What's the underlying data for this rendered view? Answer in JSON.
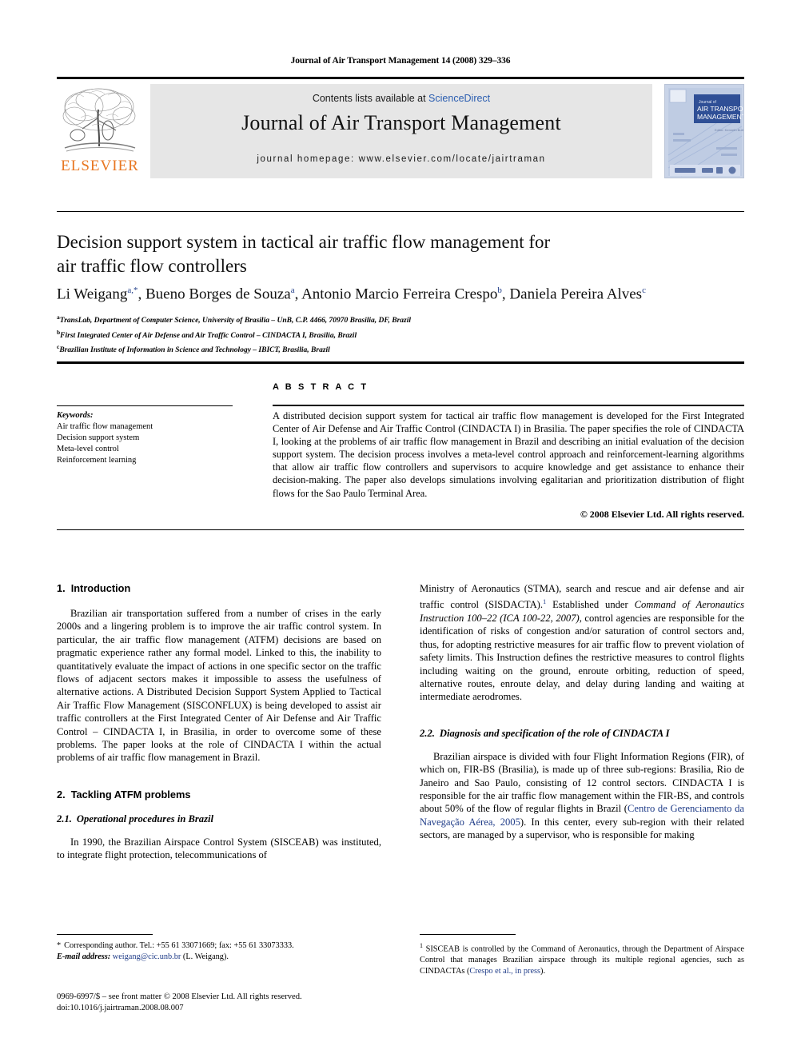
{
  "running_head": "Journal of Air Transport Management 14 (2008) 329–336",
  "masthead": {
    "contents_prefix": "Contents lists available at ",
    "sciencedirect": "ScienceDirect",
    "journal_title": "Journal of Air Transport Management",
    "homepage": "journal homepage: www.elsevier.com/locate/jairtraman",
    "publisher_name": "ELSEVIER",
    "cover_line1": "Journal of",
    "cover_line2": "AIR TRANSPORT",
    "cover_line3": "MANAGEMENT",
    "accent_orange": "#E87722",
    "link_blue": "#2a5db0",
    "band_gray": "#e6e6e6"
  },
  "title": {
    "line1": "Decision support system in tactical air traffic flow management for",
    "line2": "air traffic flow controllers"
  },
  "authors": [
    {
      "name": "Li Weigang",
      "marks": "a,*"
    },
    {
      "name": "Bueno Borges de Souza",
      "marks": "a"
    },
    {
      "name": "Antonio Marcio Ferreira Crespo",
      "marks": "b"
    },
    {
      "name": "Daniela Pereira Alves",
      "marks": "c"
    }
  ],
  "affiliations": [
    {
      "mark": "a",
      "text": "TransLab, Department of Computer Science, University of Brasilia – UnB, C.P. 4466, 70970 Brasilia, DF, Brazil"
    },
    {
      "mark": "b",
      "text": "First Integrated Center of Air Defense and Air Traffic Control – CINDACTA I, Brasilia, Brazil"
    },
    {
      "mark": "c",
      "text": "Brazilian Institute of Information in Science and Technology – IBICT, Brasilia, Brazil"
    }
  ],
  "keywords": {
    "heading": "Keywords:",
    "items": [
      "Air traffic flow management",
      "Decision support system",
      "Meta-level control",
      "Reinforcement learning"
    ]
  },
  "abstract": {
    "heading": "A B S T R A C T",
    "body": "A distributed decision support system for tactical air traffic flow management is developed for the First Integrated Center of Air Defense and Air Traffic Control (CINDACTA I) in Brasilia. The paper specifies the role of CINDACTA I, looking at the problems of air traffic flow management in Brazil and describing an initial evaluation of the decision support system. The decision process involves a meta-level control approach and reinforcement-learning algorithms that allow air traffic flow controllers and supervisors to acquire knowledge and get assistance to enhance their decision-making. The paper also develops simulations involving egalitarian and prioritization distribution of flight flows for the Sao Paulo Terminal Area.",
    "copyright": "© 2008 Elsevier Ltd. All rights reserved."
  },
  "sections": {
    "intro": {
      "number": "1.",
      "heading": "Introduction",
      "paragraph": "Brazilian air transportation suffered from a number of crises in the early 2000s and a lingering problem is to improve the air traffic control system. In particular, the air traffic flow management (ATFM) decisions are based on pragmatic experience rather any formal model. Linked to this, the inability to quantitatively evaluate the impact of actions in one specific sector on the traffic flows of adjacent sectors makes it impossible to assess the usefulness of alternative actions. A Distributed Decision Support System Applied to Tactical Air Traffic Flow Management (SISCONFLUX) is being developed to assist air traffic controllers at the First Integrated Center of Air Defense and Air Traffic Control – CINDACTA I, in Brasilia, in order to overcome some of these problems. The paper looks at the role of CINDACTA I within the actual problems of air traffic flow management in Brazil."
    },
    "tackling": {
      "number": "2.",
      "heading": "Tackling ATFM problems"
    },
    "operational": {
      "number": "2.1.",
      "heading": "Operational procedures in Brazil",
      "para_left_start": "In 1990, the Brazilian Airspace Control System (SISCEAB) was instituted, to integrate flight protection, telecommunications of",
      "para_right_a": "Ministry of Aeronautics (STMA), search and rescue and air defense and air traffic control (SISDACTA).",
      "para_right_footmark": "1",
      "para_right_b": " Established under ",
      "para_right_italic": "Command of Aeronautics Instruction 100–22 (ICA 100-22, 2007)",
      "para_right_c": ", control agencies are responsible for the identification of risks of congestion and/or saturation of control sectors and, thus, for adopting restrictive measures for air traffic flow to prevent violation of safety limits. This Instruction defines the restrictive measures to control flights including waiting on the ground, enroute orbiting, reduction of speed, alternative routes, enroute delay, and delay during landing and waiting at intermediate aerodromes."
    },
    "diagnosis": {
      "number": "2.2.",
      "heading": "Diagnosis and specification of the role of CINDACTA I",
      "para_a": "Brazilian airspace is divided with four Flight Information Regions (FIR), of which on, FIR-BS (Brasilia), is made up of three sub-regions: Brasilia, Rio de Janeiro and Sao Paulo, consisting of 12 control sectors. CINDACTA I is responsible for the air traffic flow management within the FIR-BS, and controls about 50% of the flow of regular flights in Brazil (",
      "citation": "Centro de Gerenciamento da Navegação Aérea, 2005",
      "para_b": "). In this center, every sub-region with their related sectors, are managed by a supervisor, who is responsible for making"
    }
  },
  "footnotes": {
    "corresponding": {
      "star": "*",
      "text": "Corresponding author. Tel.: +55 61 33071669; fax: +55 61 33073333.",
      "email_label": "E-mail address:",
      "email": "weigang@cic.unb.br",
      "email_owner": "(L. Weigang)."
    },
    "note1": {
      "mark": "1",
      "text_a": "SISCEAB is controlled by the Command of Aeronautics, through the Department of Airspace Control that manages Brazilian airspace through its multiple regional agencies, such as CINDACTAs (",
      "citation": "Crespo et al., in press",
      "text_b": ")."
    }
  },
  "imprint": {
    "line1": "0969-6997/$ – see front matter © 2008 Elsevier Ltd. All rights reserved.",
    "line2": "doi:10.1016/j.jairtraman.2008.08.007"
  }
}
